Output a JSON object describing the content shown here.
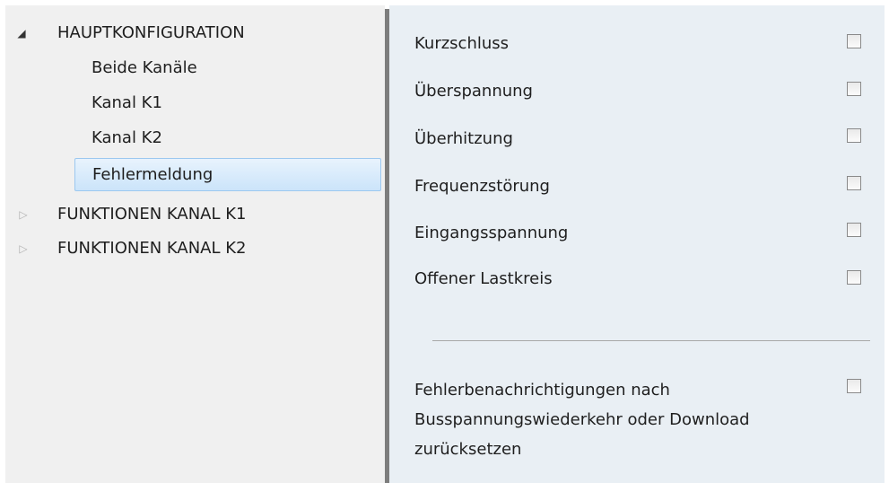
{
  "tree": {
    "root": {
      "label": "HAUPTKONFIGURATION",
      "arrow": "◢"
    },
    "children": [
      {
        "label": "Beide Kanäle"
      },
      {
        "label": "Kanal K1"
      },
      {
        "label": "Kanal K2"
      },
      {
        "label": "Fehlermeldung"
      }
    ],
    "collapsed": [
      {
        "label": "FUNKTIONEN KANAL K1",
        "arrow": "▷"
      },
      {
        "label": "FUNKTIONEN KANAL K2",
        "arrow": "▷"
      }
    ]
  },
  "panel": {
    "options": [
      {
        "label": "Kurzschluss",
        "checked": false
      },
      {
        "label": "Überspannung",
        "checked": false
      },
      {
        "label": "Überhitzung",
        "checked": false
      },
      {
        "label": "Frequenzstörung",
        "checked": false
      },
      {
        "label": "Eingangsspannung",
        "checked": false
      },
      {
        "label": "Offener Lastkreis",
        "checked": false
      }
    ],
    "reset_option": {
      "label": "Fehlerbenachrichtigungen nach Busspannungswiederkehr oder Download zurücksetzen",
      "checked": false
    }
  }
}
